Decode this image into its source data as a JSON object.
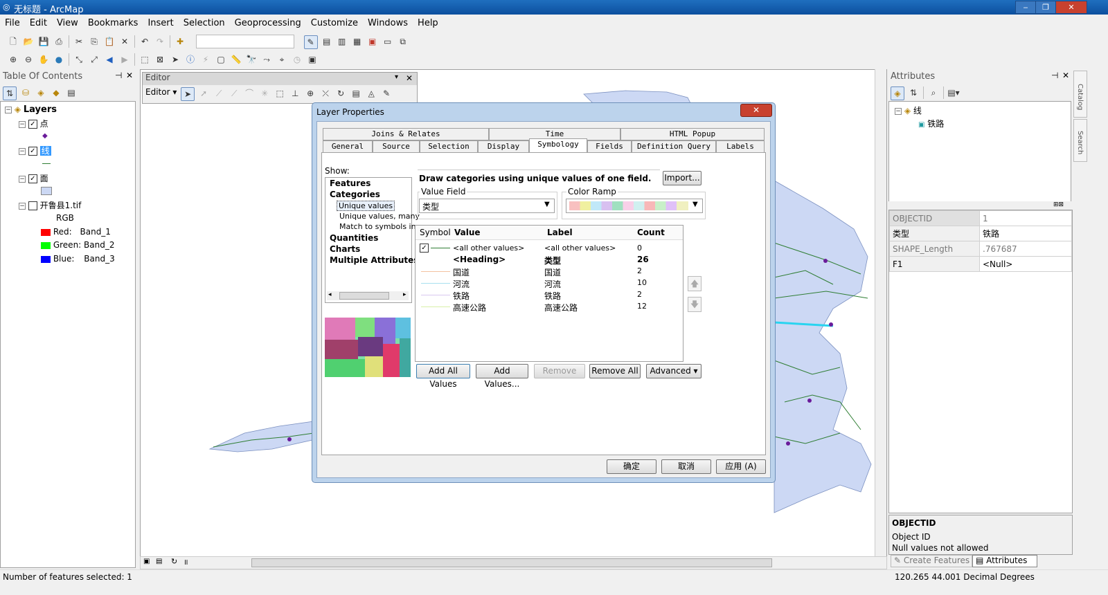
{
  "window": {
    "title": "无标题 - ArcMap"
  },
  "menu": [
    "File",
    "Edit",
    "View",
    "Bookmarks",
    "Insert",
    "Selection",
    "Geoprocessing",
    "Customize",
    "Windows",
    "Help"
  ],
  "toc": {
    "title": "Table Of Contents",
    "root": "Layers",
    "layers": [
      {
        "name": "点"
      },
      {
        "name": "线"
      },
      {
        "name": "面"
      },
      {
        "name": "开鲁县1.tif"
      }
    ],
    "raster": {
      "type": "RGB",
      "bands": [
        {
          "label": "Red:",
          "band": "Band_1",
          "color": "#ff0000"
        },
        {
          "label": "Green:",
          "band": "Band_2",
          "color": "#00ff00"
        },
        {
          "label": "Blue:",
          "band": "Band_3",
          "color": "#0000ff"
        }
      ]
    }
  },
  "editor": {
    "title": "Editor",
    "menu": "Editor ▾"
  },
  "dialog": {
    "title": "Layer Properties",
    "tabs_row1": [
      "Joins & Relates",
      "Time",
      "HTML Popup"
    ],
    "tabs_row2": [
      "General",
      "Source",
      "Selection",
      "Display",
      "Symbology",
      "Fields",
      "Definition Query",
      "Labels"
    ],
    "show_label": "Show:",
    "show_items": [
      "Features",
      "Categories",
      "Unique values",
      "Unique values, many",
      "Match to symbols in a",
      "Quantities",
      "Charts",
      "Multiple Attributes"
    ],
    "heading": "Draw categories using unique values of one field.",
    "import": "Import...",
    "value_field_label": "Value Field",
    "value_field": "类型",
    "color_ramp_label": "Color Ramp",
    "columns": [
      "Symbol",
      "Value",
      "Label",
      "Count"
    ],
    "rows": [
      {
        "value": "<all other values>",
        "label": "<all other values>",
        "count": "0",
        "color": "#2e7d32"
      },
      {
        "value": "<Heading>",
        "label": "类型",
        "count": "26",
        "color": ""
      },
      {
        "value": "国道",
        "label": "国道",
        "count": "2",
        "color": "#f4c2a0"
      },
      {
        "value": "河流",
        "label": "河流",
        "count": "10",
        "color": "#a8e0f0"
      },
      {
        "value": "铁路",
        "label": "铁路",
        "count": "2",
        "color": "#d8c8f0"
      },
      {
        "value": "高速公路",
        "label": "高速公路",
        "count": "12",
        "color": "#d8f0a8"
      }
    ],
    "buttons": [
      "Add All Values",
      "Add Values...",
      "Remove",
      "Remove All",
      "Advanced ▾"
    ],
    "footer": [
      "确定",
      "取消",
      "应用 (A)"
    ]
  },
  "attributes": {
    "title": "Attributes",
    "tree_root": "线",
    "tree_child": "铁路",
    "fields": [
      {
        "name": "OBJECTID",
        "value": "1"
      },
      {
        "name": "类型",
        "value": "铁路"
      },
      {
        "name": "SHAPE_Length",
        "value": ".767687"
      },
      {
        "name": "F1",
        "value": "<Null>"
      }
    ],
    "info_title": "OBJECTID",
    "info_line1": "Object ID",
    "info_line2": "Null values not allowed",
    "tabs": [
      "Create Features",
      "Attributes"
    ]
  },
  "side_tabs": [
    "Catalog",
    "Search"
  ],
  "status": {
    "left": "Number of features selected: 1",
    "right": "120.265  44.001 Decimal Degrees"
  }
}
